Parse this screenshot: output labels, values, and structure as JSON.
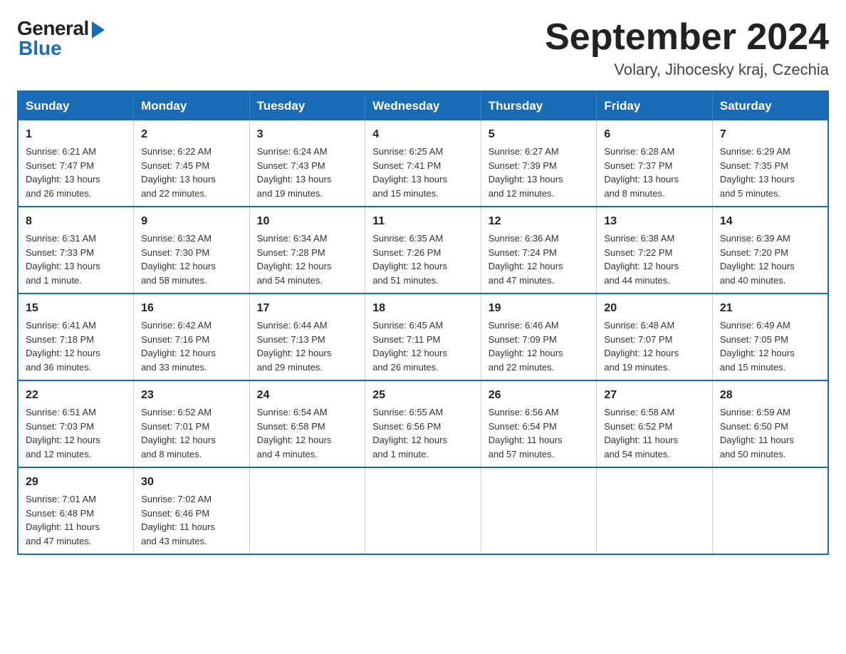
{
  "logo": {
    "general": "General",
    "blue": "Blue"
  },
  "title": "September 2024",
  "subtitle": "Volary, Jihocesky kraj, Czechia",
  "days_of_week": [
    "Sunday",
    "Monday",
    "Tuesday",
    "Wednesday",
    "Thursday",
    "Friday",
    "Saturday"
  ],
  "weeks": [
    [
      {
        "day": "1",
        "info": "Sunrise: 6:21 AM\nSunset: 7:47 PM\nDaylight: 13 hours\nand 26 minutes."
      },
      {
        "day": "2",
        "info": "Sunrise: 6:22 AM\nSunset: 7:45 PM\nDaylight: 13 hours\nand 22 minutes."
      },
      {
        "day": "3",
        "info": "Sunrise: 6:24 AM\nSunset: 7:43 PM\nDaylight: 13 hours\nand 19 minutes."
      },
      {
        "day": "4",
        "info": "Sunrise: 6:25 AM\nSunset: 7:41 PM\nDaylight: 13 hours\nand 15 minutes."
      },
      {
        "day": "5",
        "info": "Sunrise: 6:27 AM\nSunset: 7:39 PM\nDaylight: 13 hours\nand 12 minutes."
      },
      {
        "day": "6",
        "info": "Sunrise: 6:28 AM\nSunset: 7:37 PM\nDaylight: 13 hours\nand 8 minutes."
      },
      {
        "day": "7",
        "info": "Sunrise: 6:29 AM\nSunset: 7:35 PM\nDaylight: 13 hours\nand 5 minutes."
      }
    ],
    [
      {
        "day": "8",
        "info": "Sunrise: 6:31 AM\nSunset: 7:33 PM\nDaylight: 13 hours\nand 1 minute."
      },
      {
        "day": "9",
        "info": "Sunrise: 6:32 AM\nSunset: 7:30 PM\nDaylight: 12 hours\nand 58 minutes."
      },
      {
        "day": "10",
        "info": "Sunrise: 6:34 AM\nSunset: 7:28 PM\nDaylight: 12 hours\nand 54 minutes."
      },
      {
        "day": "11",
        "info": "Sunrise: 6:35 AM\nSunset: 7:26 PM\nDaylight: 12 hours\nand 51 minutes."
      },
      {
        "day": "12",
        "info": "Sunrise: 6:36 AM\nSunset: 7:24 PM\nDaylight: 12 hours\nand 47 minutes."
      },
      {
        "day": "13",
        "info": "Sunrise: 6:38 AM\nSunset: 7:22 PM\nDaylight: 12 hours\nand 44 minutes."
      },
      {
        "day": "14",
        "info": "Sunrise: 6:39 AM\nSunset: 7:20 PM\nDaylight: 12 hours\nand 40 minutes."
      }
    ],
    [
      {
        "day": "15",
        "info": "Sunrise: 6:41 AM\nSunset: 7:18 PM\nDaylight: 12 hours\nand 36 minutes."
      },
      {
        "day": "16",
        "info": "Sunrise: 6:42 AM\nSunset: 7:16 PM\nDaylight: 12 hours\nand 33 minutes."
      },
      {
        "day": "17",
        "info": "Sunrise: 6:44 AM\nSunset: 7:13 PM\nDaylight: 12 hours\nand 29 minutes."
      },
      {
        "day": "18",
        "info": "Sunrise: 6:45 AM\nSunset: 7:11 PM\nDaylight: 12 hours\nand 26 minutes."
      },
      {
        "day": "19",
        "info": "Sunrise: 6:46 AM\nSunset: 7:09 PM\nDaylight: 12 hours\nand 22 minutes."
      },
      {
        "day": "20",
        "info": "Sunrise: 6:48 AM\nSunset: 7:07 PM\nDaylight: 12 hours\nand 19 minutes."
      },
      {
        "day": "21",
        "info": "Sunrise: 6:49 AM\nSunset: 7:05 PM\nDaylight: 12 hours\nand 15 minutes."
      }
    ],
    [
      {
        "day": "22",
        "info": "Sunrise: 6:51 AM\nSunset: 7:03 PM\nDaylight: 12 hours\nand 12 minutes."
      },
      {
        "day": "23",
        "info": "Sunrise: 6:52 AM\nSunset: 7:01 PM\nDaylight: 12 hours\nand 8 minutes."
      },
      {
        "day": "24",
        "info": "Sunrise: 6:54 AM\nSunset: 6:58 PM\nDaylight: 12 hours\nand 4 minutes."
      },
      {
        "day": "25",
        "info": "Sunrise: 6:55 AM\nSunset: 6:56 PM\nDaylight: 12 hours\nand 1 minute."
      },
      {
        "day": "26",
        "info": "Sunrise: 6:56 AM\nSunset: 6:54 PM\nDaylight: 11 hours\nand 57 minutes."
      },
      {
        "day": "27",
        "info": "Sunrise: 6:58 AM\nSunset: 6:52 PM\nDaylight: 11 hours\nand 54 minutes."
      },
      {
        "day": "28",
        "info": "Sunrise: 6:59 AM\nSunset: 6:50 PM\nDaylight: 11 hours\nand 50 minutes."
      }
    ],
    [
      {
        "day": "29",
        "info": "Sunrise: 7:01 AM\nSunset: 6:48 PM\nDaylight: 11 hours\nand 47 minutes."
      },
      {
        "day": "30",
        "info": "Sunrise: 7:02 AM\nSunset: 6:46 PM\nDaylight: 11 hours\nand 43 minutes."
      },
      {
        "day": "",
        "info": ""
      },
      {
        "day": "",
        "info": ""
      },
      {
        "day": "",
        "info": ""
      },
      {
        "day": "",
        "info": ""
      },
      {
        "day": "",
        "info": ""
      }
    ]
  ]
}
